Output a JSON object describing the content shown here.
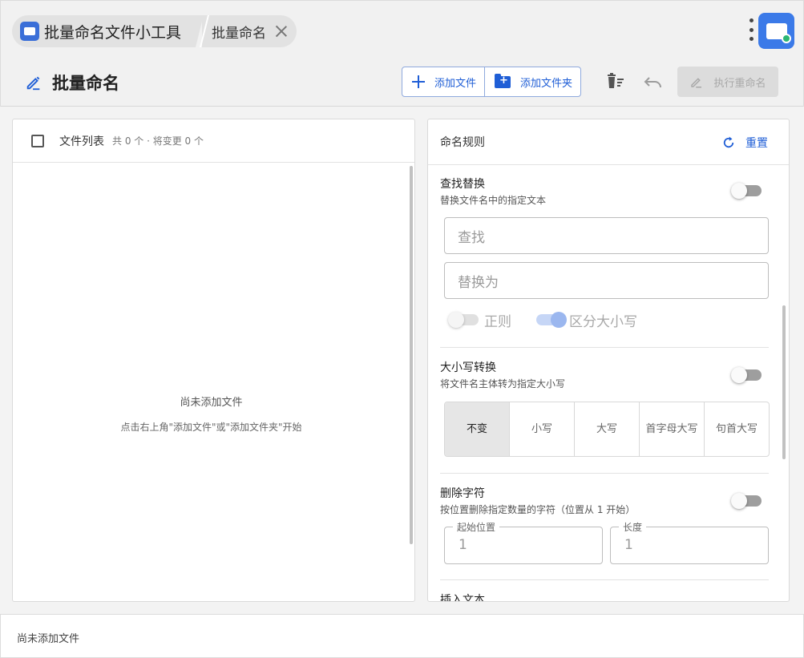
{
  "window": {
    "tab_app": "批量命名文件小工具",
    "tab_page": "批量命名"
  },
  "toolbar": {
    "title": "批量命名",
    "add_file": "添加文件",
    "add_folder": "添加文件夹",
    "execute": "执行重命名"
  },
  "file_list": {
    "header": "文件列表",
    "summary": "共 0 个 · 将变更 0 个",
    "empty_title": "尚未添加文件",
    "empty_hint": "点击右上角\"添加文件\"或\"添加文件夹\"开始"
  },
  "rules": {
    "header": "命名规则",
    "reset": "重置",
    "find_replace": {
      "title": "查找替换",
      "subtitle": "替换文件名中的指定文本",
      "find_placeholder": "查找",
      "replace_placeholder": "替换为",
      "regex_label": "正则",
      "case_label": "区分大小写"
    },
    "case_convert": {
      "title": "大小写转换",
      "subtitle": "将文件名主体转为指定大小写",
      "options": [
        "不变",
        "小写",
        "大写",
        "首字母大写",
        "句首大写"
      ],
      "selected": "不变"
    },
    "delete_chars": {
      "title": "删除字符",
      "subtitle": "按位置删除指定数量的字符（位置从 1 开始）",
      "start_label": "起始位置",
      "start_value": "1",
      "length_label": "长度",
      "length_value": "1"
    },
    "insert_text": {
      "title": "插入文本"
    }
  },
  "footer": {
    "status": "尚未添加文件"
  }
}
